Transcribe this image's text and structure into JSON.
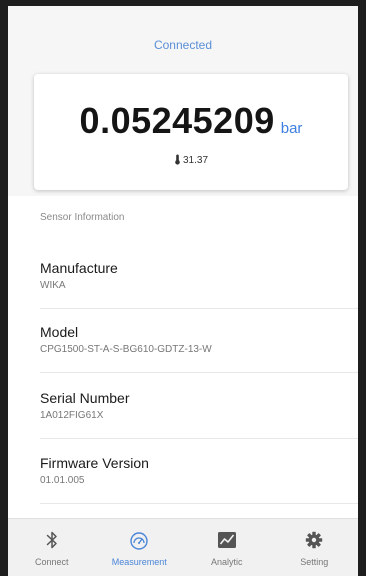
{
  "status": {
    "text": "Connected",
    "color": "#5b8fd6"
  },
  "reading": {
    "value": "0.05245209",
    "unit": "bar",
    "temperature": "31.37",
    "temperature_icon": "thermometer-icon"
  },
  "sensor_info": {
    "title": "Sensor Information",
    "rows": [
      {
        "label": "Manufacture",
        "value": "WIKA"
      },
      {
        "label": "Model",
        "value": "CPG1500-ST-A-S-BG610-GDTZ-13-W"
      },
      {
        "label": "Serial Number",
        "value": "1A012FIG61X"
      },
      {
        "label": "Firmware Version",
        "value": "01.01.005"
      }
    ]
  },
  "nav": {
    "active_color": "#4b86d8",
    "items": [
      {
        "label": "Connect",
        "icon": "bluetooth-icon",
        "active": false
      },
      {
        "label": "Measurement",
        "icon": "gauge-icon",
        "active": true
      },
      {
        "label": "Analytic",
        "icon": "chart-icon",
        "active": false
      },
      {
        "label": "Setting",
        "icon": "gear-icon",
        "active": false
      }
    ]
  }
}
